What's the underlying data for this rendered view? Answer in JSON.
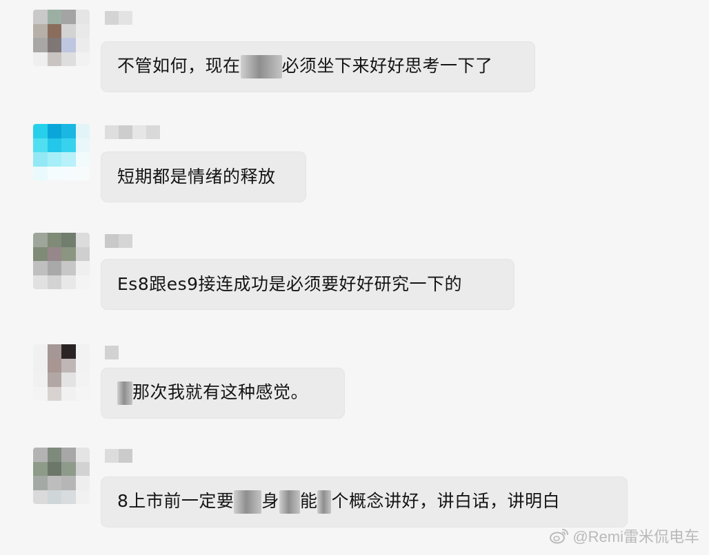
{
  "messages": [
    {
      "text_parts": [
        "不管如何，现在",
        "[r:60]",
        "必须坐下来好好思考一下了"
      ],
      "avatar_colors": [
        "#c9c9c9",
        "#9bb0a3",
        "#a4a4a4",
        "#e5e5e5",
        "#b6b0a8",
        "#8a6d5c",
        "#d3d3d3",
        "#e9e9e9",
        "#a9a7a6",
        "#7f7775",
        "#bfc6e0",
        "#ececec",
        "#efefef",
        "#c9c4c1",
        "#dedede",
        "#f2f2f2"
      ],
      "name_blocks": [
        "#d4d4d4",
        "#e3e3e3"
      ]
    },
    {
      "text_parts": [
        "短期都是情绪的释放"
      ],
      "avatar_colors": [
        "#27d0ea",
        "#0aa6d9",
        "#1ab7e2",
        "#e2f4f8",
        "#50dff1",
        "#24c6ea",
        "#39d2ee",
        "#e9f7fa",
        "#92e9f5",
        "#a6eff8",
        "#b8f1f9",
        "#f2fbfc",
        "#eafafc",
        "#f4fcfd",
        "#f6fcfd",
        "#f8fbfc"
      ],
      "name_blocks": [
        "#dedede",
        "#cdcdcd",
        "#e6e6e6",
        "#d9d9d9"
      ]
    },
    {
      "text_parts": [
        "Es8跟es9接连成功是必须要好好研究一下的"
      ],
      "avatar_colors": [
        "#9ea69b",
        "#7f8a77",
        "#717d6d",
        "#dcdcdc",
        "#7f8a77",
        "#96878a",
        "#8b9581",
        "#cfcfcf",
        "#bfbfbf",
        "#a9a9a9",
        "#c7c7c7",
        "#efefef",
        "#e1e1e1",
        "#d3d3d3",
        "#e8e8e8",
        "#f4f4f4"
      ],
      "name_blocks": [
        "#c9c9c9",
        "#d5d5d5"
      ]
    },
    {
      "text_parts": [
        "[r:22]",
        "那次我就有这种感觉。"
      ],
      "avatar_colors": [
        "#f1f1f1",
        "#a49795",
        "#2b2424",
        "#f2f2f2",
        "#f0f0f0",
        "#a99693",
        "#bfb7b6",
        "#f2f2f2",
        "#f1f1f1",
        "#b2a7a4",
        "#e3e3e3",
        "#f3f3f3",
        "#f4f4f4",
        "#d8d2d1",
        "#f1f1f1",
        "#f5f5f5"
      ],
      "name_blocks": [
        "#d2d2d2"
      ]
    },
    {
      "text_parts": [
        "8上市前一定要",
        "[r:40]",
        "身",
        "[r:30]",
        "能",
        "[r:20]",
        "个概念讲好，讲白话，讲明白"
      ],
      "avatar_colors": [
        "#b3b3b3",
        "#7e8a7c",
        "#a7a7a7",
        "#e4e4e4",
        "#8d9b88",
        "#6d7769",
        "#8e9b8b",
        "#d2d2d2",
        "#a3aaa6",
        "#bdbdbd",
        "#b6b6b6",
        "#eeeeee",
        "#dadada",
        "#cfd6d9",
        "#d8dcde",
        "#f1f1f1"
      ],
      "name_blocks": [
        "#dcdcdc",
        "#cbcbcb"
      ]
    }
  ],
  "watermark": {
    "text": "@Remi雷米侃电车",
    "icon": "weibo-icon",
    "color": "#b9b9b9"
  }
}
